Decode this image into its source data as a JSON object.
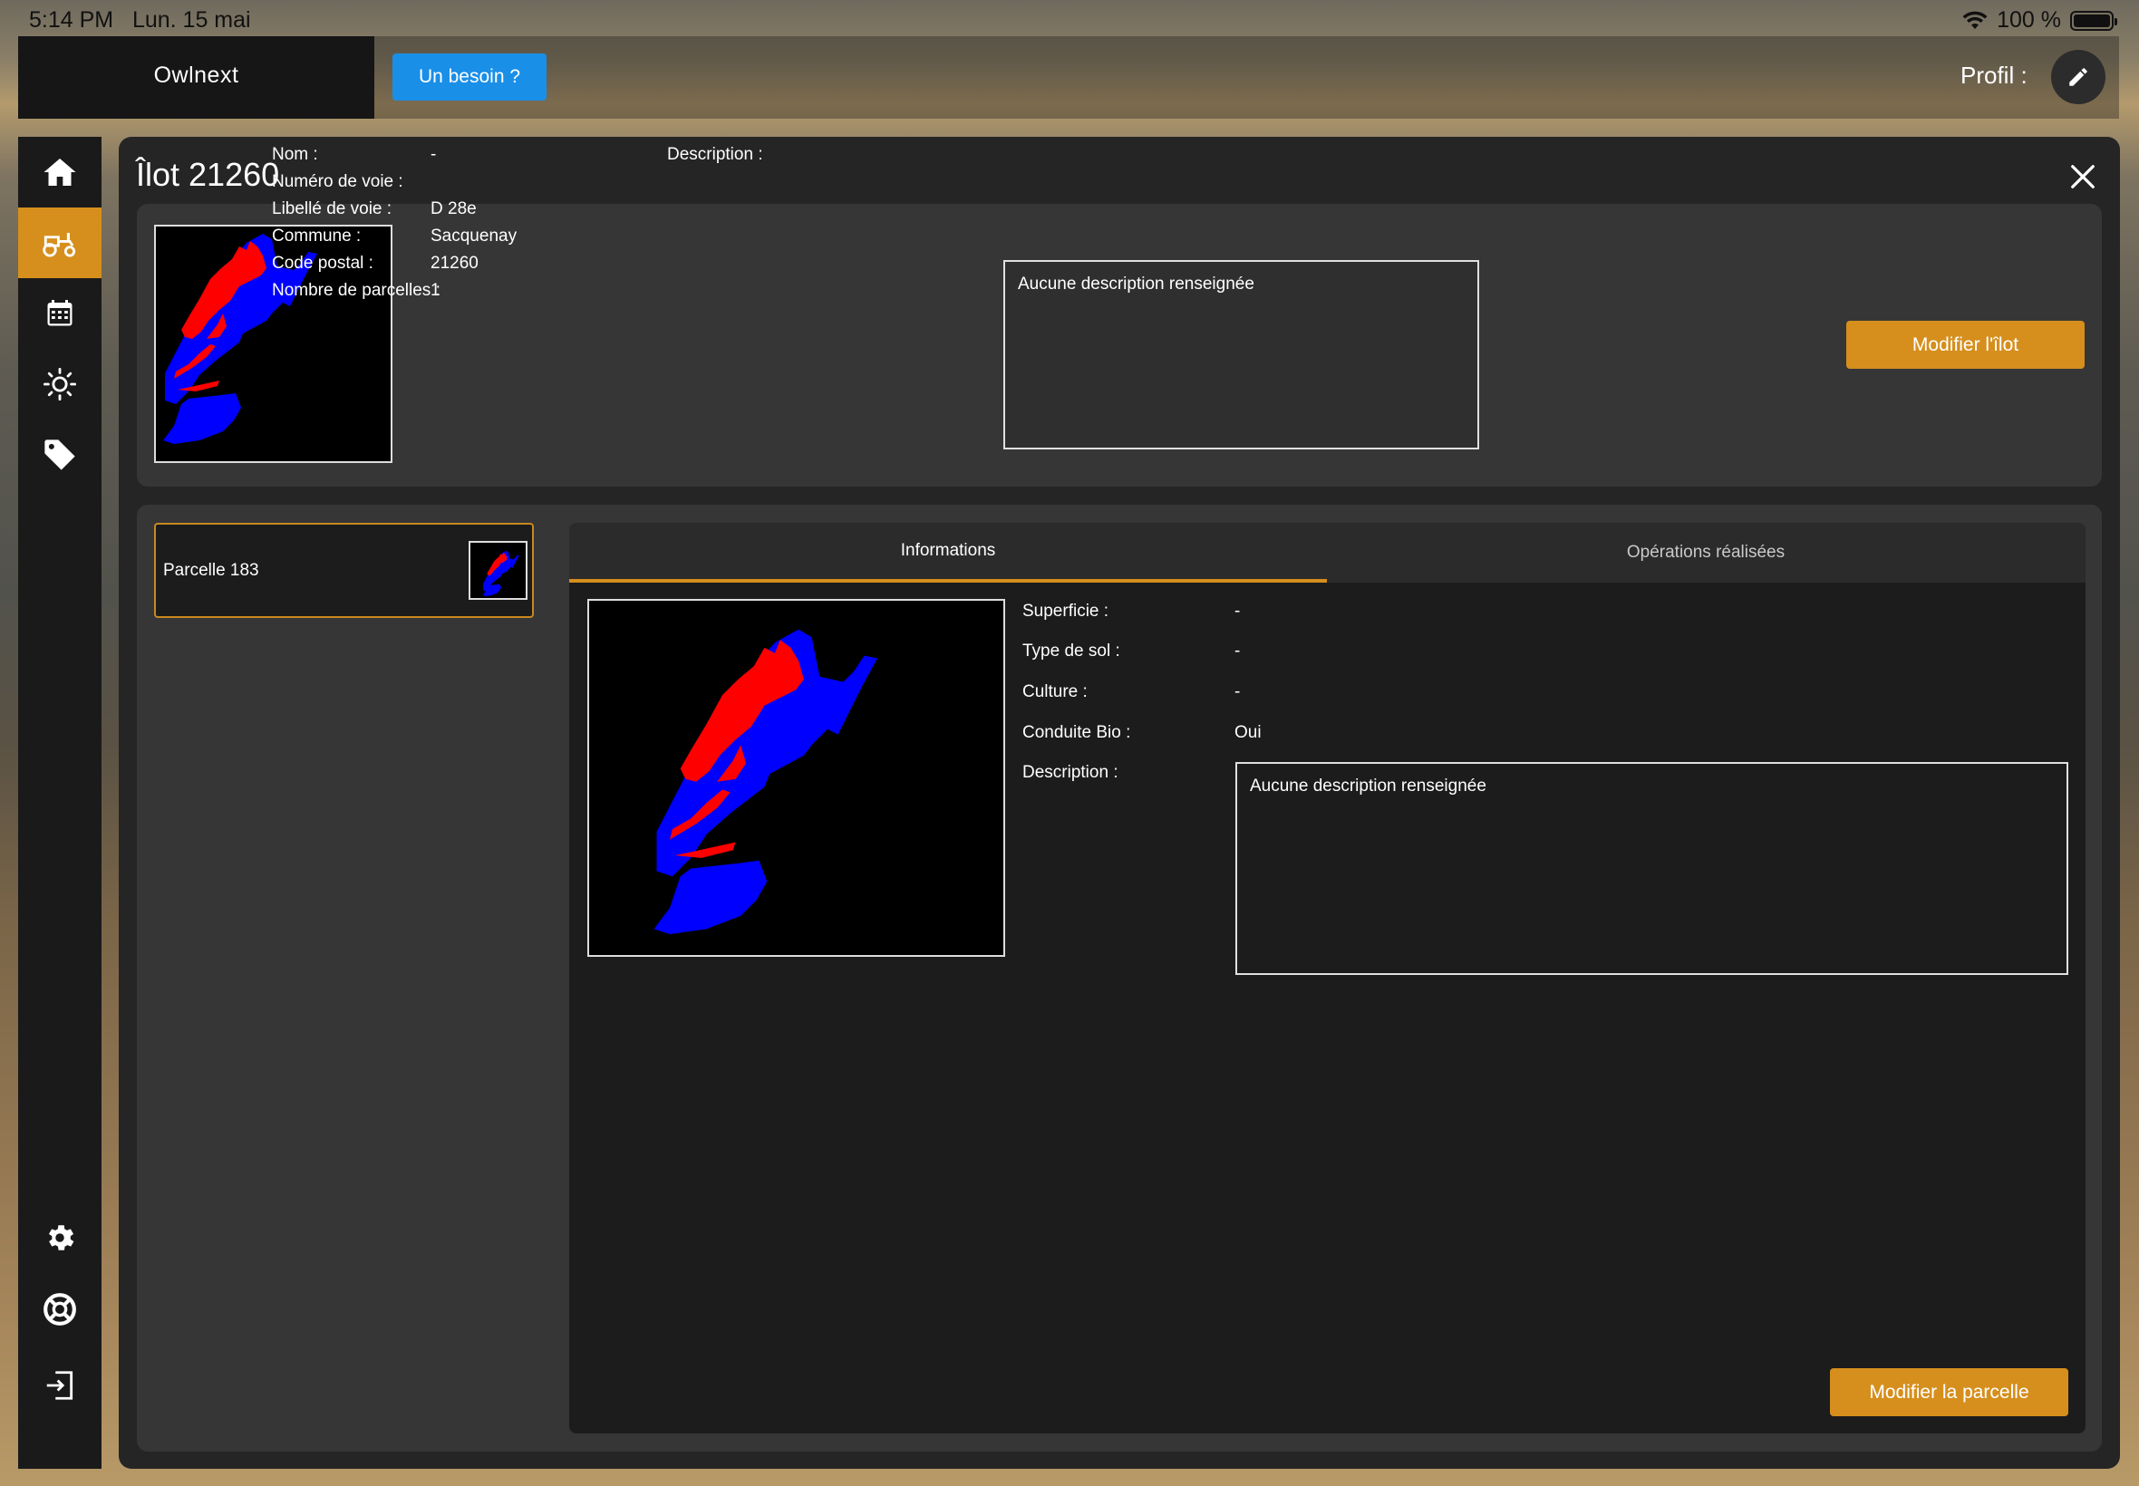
{
  "status_bar": {
    "time": "5:14 PM",
    "date": "Lun. 15 mai",
    "battery": "100 %"
  },
  "topbar": {
    "brand": "Owlnext",
    "need_button": "Un besoin ?",
    "profile_label": "Profil :"
  },
  "nav": {
    "items": [
      "home-icon",
      "tractor-icon",
      "calendar-icon",
      "sun-icon",
      "tag-icon",
      "gear-icon",
      "lifebuoy-icon",
      "logout-icon"
    ],
    "active": "tractor-icon",
    "accent": "#d68f1d"
  },
  "ilot": {
    "title": "Îlot 21260",
    "fields": [
      {
        "label": "Nom :",
        "value": "-"
      },
      {
        "label": "Numéro de voie :",
        "value": ""
      },
      {
        "label": "Libellé de voie :",
        "value": "D 28e"
      },
      {
        "label": "Commune :",
        "value": "Sacquenay"
      },
      {
        "label": "Code postal :",
        "value": "21260"
      },
      {
        "label": "Nombre de parcelles :",
        "value": "1"
      }
    ],
    "description_label": "Description :",
    "description": "Aucune description renseignée",
    "edit_button": "Modifier l'îlot"
  },
  "parcel_list": [
    {
      "label": "Parcelle 183"
    }
  ],
  "parcel_detail": {
    "tabs": [
      {
        "label": "Informations",
        "active": true
      },
      {
        "label": "Opérations réalisées",
        "active": false
      }
    ],
    "fields": [
      {
        "label": "Superficie :",
        "value": "-"
      },
      {
        "label": "Type de sol :",
        "value": "-"
      },
      {
        "label": "Culture :",
        "value": "-"
      },
      {
        "label": "Conduite Bio :",
        "value": "Oui"
      }
    ],
    "description_label": "Description :",
    "description": "Aucune description renseignée",
    "edit_button": "Modifier la parcelle"
  },
  "colors": {
    "brand_blue": "#1a8fe8",
    "accent_gold": "#d68f1d",
    "map_blue": "#0000ff",
    "map_red": "#ff0000"
  }
}
